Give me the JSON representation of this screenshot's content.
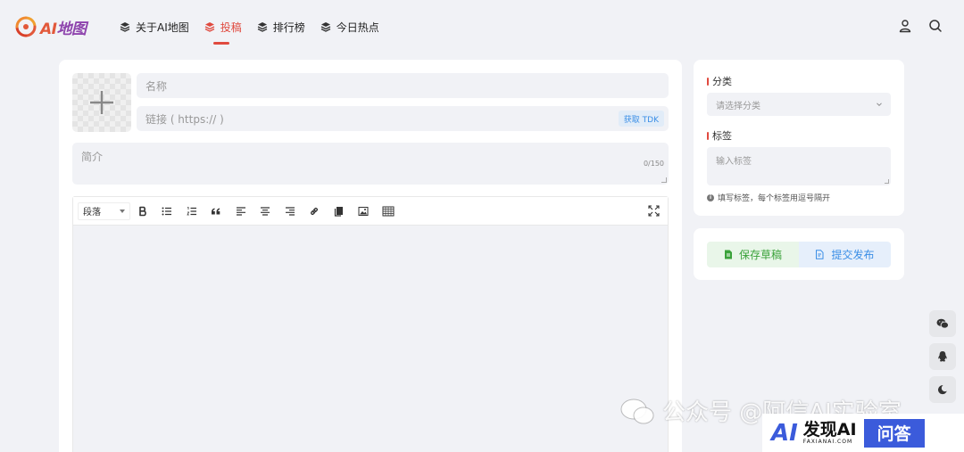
{
  "header": {
    "logo_text_a": "AI",
    "logo_text_b": "地图",
    "nav": [
      {
        "label": "关于AI地图"
      },
      {
        "label": "投稿"
      },
      {
        "label": "排行榜"
      },
      {
        "label": "今日热点"
      }
    ]
  },
  "form": {
    "name_placeholder": "名称",
    "link_placeholder": "链接 ( https:// )",
    "tdk_button": "获取 TDK",
    "intro_placeholder": "简介",
    "intro_count": "0/150"
  },
  "editor": {
    "paragraph_select": "段落",
    "toolbar_icons": [
      "bold-icon",
      "bullet-list-icon",
      "numbered-list-icon",
      "quote-icon",
      "align-left-icon",
      "align-center-icon",
      "align-right-icon",
      "link-icon",
      "copy-icon",
      "image-icon",
      "table-icon"
    ],
    "fullscreen_icon": "fullscreen-icon"
  },
  "sidebar": {
    "category_label": "分类",
    "category_placeholder": "请选择分类",
    "tags_label": "标签",
    "tags_placeholder": "输入标签",
    "tags_hint": "填写标签，每个标签用逗号隔开",
    "save_draft": "保存草稿",
    "submit": "提交发布"
  },
  "watermark": {
    "text": "公众号 @阿信AI实验室",
    "logo_cn": "发现AI",
    "logo_en": "FAXIANAI.COM",
    "logo_qa": "问答",
    "logo_ai": "AI"
  },
  "colors": {
    "accent_red": "#e04a3f",
    "green": "#3aa23a",
    "blue": "#3a8ee6",
    "background": "#f1f2f6"
  }
}
